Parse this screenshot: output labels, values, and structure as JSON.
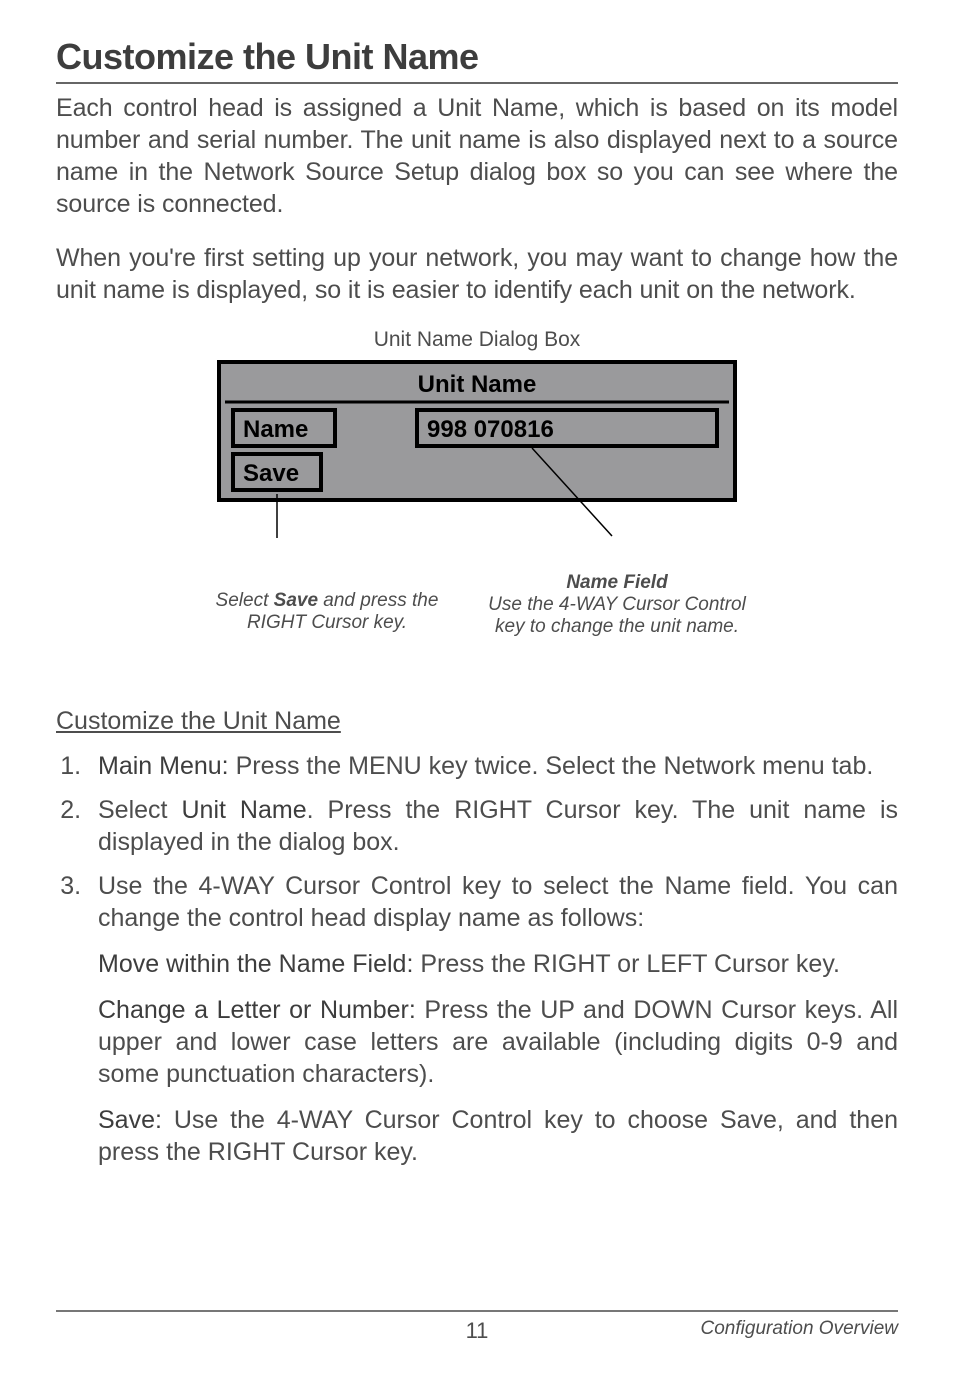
{
  "title": "Customize the Unit Name",
  "para1": "Each control head is assigned a Unit Name, which is based on its model number and serial number. The unit name is also displayed next to a source name in the Network Source Setup dialog box so you can see where the source is connected.",
  "para2": "When you're first setting up your network, you may want to change how the unit name is displayed, so it is easier to identify each unit on the network.",
  "figure_caption": "Unit Name Dialog Box",
  "dialog": {
    "title": "Unit Name",
    "name_label": "Name",
    "name_value": "998 070816",
    "save_label": "Save"
  },
  "callouts": {
    "left_pre": "Select ",
    "left_bold": "Save",
    "left_post": " and press the RIGHT Cursor key.",
    "right_title": "Name Field",
    "right_body": "Use the 4-WAY Cursor Control key to change the unit name."
  },
  "section_heading": "Customize the Unit Name",
  "steps": {
    "s1_bold": "Main Menu:",
    "s1_rest": " Press the MENU key twice. Select the Network menu tab.",
    "s2_pre": "Select ",
    "s2_bold": "Unit Name",
    "s2_rest": ". Press the RIGHT Cursor key. The unit name is displayed in the dialog box.",
    "s3_body": "Use the 4-WAY Cursor Control key to select the Name field. You can change the control head display name as follows:",
    "s3_sub1_bold": "Move within the Name Field:",
    "s3_sub1_rest": " Press the RIGHT or LEFT Cursor key.",
    "s3_sub2_bold": "Change a Letter or Number:",
    "s3_sub2_rest": " Press the UP and DOWN Cursor keys. All upper and lower case letters are available (including digits 0-9 and some punctuation characters).",
    "s3_sub3_bold": "Save:",
    "s3_sub3_rest": " Use the 4-WAY Cursor Control key to choose Save, and then press the RIGHT Cursor key."
  },
  "footer": {
    "page_number": "11",
    "section": "Configuration Overview"
  }
}
